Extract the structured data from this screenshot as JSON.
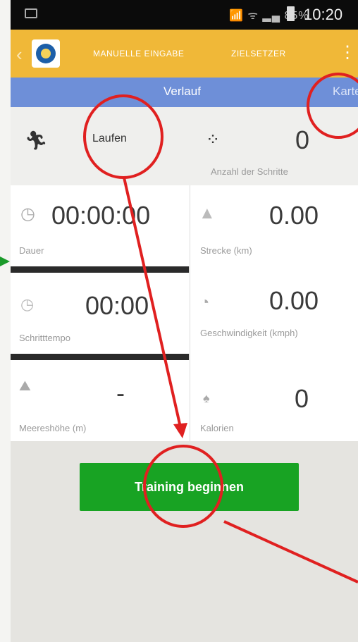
{
  "status_bar": {
    "time": "10:20",
    "signal_text": "📶 ᯤ ▂▄ 85%"
  },
  "action_bar": {
    "back_glyph": "‹",
    "tabs": [
      "MANUELLE EINGABE",
      "ZIELSETZER"
    ],
    "more_glyph": "⋮"
  },
  "sub_tabs": [
    "Verlauf",
    "Karte"
  ],
  "activity": {
    "icon": "running-person-icon",
    "label": "Laufen"
  },
  "stats": {
    "steps": {
      "value": "0",
      "label": "Anzahl der Schritte",
      "icon": "footprints-icon"
    },
    "duration": {
      "value": "00:00:00",
      "label": "Dauer",
      "icon": "clock-icon"
    },
    "distance": {
      "value": "0.00",
      "label": "Strecke (km)",
      "icon": "road-icon"
    },
    "pace": {
      "value": "00:00",
      "label": "Schritttempo",
      "icon": "clock-icon"
    },
    "speed": {
      "value": "0.00",
      "label": "Geschwindigkeit (kmph)",
      "icon": "speedometer-icon"
    },
    "altitude": {
      "value": "-",
      "label": "Meereshöhe (m)",
      "icon": "mountain-icon"
    },
    "calories": {
      "value": "0",
      "label": "Kalorien",
      "icon": "flame-icon"
    }
  },
  "start_button": {
    "label": "Training beginnen"
  },
  "colors": {
    "action_bar": "#f0b838",
    "sub_bar": "#6e8fd8",
    "start_button": "#18a323",
    "annotation_red": "#e02020"
  }
}
